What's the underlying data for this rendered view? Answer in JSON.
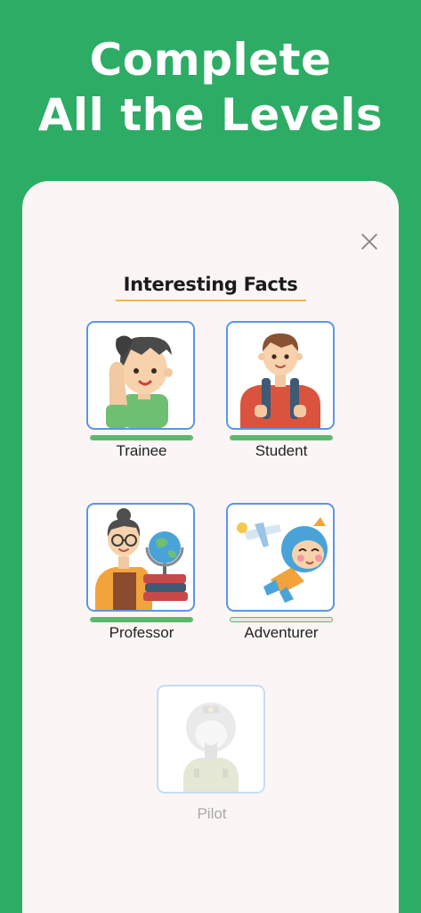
{
  "headline": {
    "line1": "Complete",
    "line2": "All the Levels"
  },
  "modal": {
    "title": "Interesting Facts",
    "levels": [
      {
        "name": "Trainee",
        "icon": "trainee-avatar-icon",
        "progress": 1.0,
        "locked": false
      },
      {
        "name": "Student",
        "icon": "student-avatar-icon",
        "progress": 1.0,
        "locked": false
      },
      {
        "name": "Professor",
        "icon": "professor-avatar-icon",
        "progress": 1.0,
        "locked": false
      },
      {
        "name": "Adventurer",
        "icon": "adventurer-avatar-icon",
        "progress": 0.0,
        "locked": false
      },
      {
        "name": "Pilot",
        "icon": "pilot-avatar-icon",
        "locked": true
      }
    ]
  },
  "colors": {
    "background": "#2dac65",
    "card": "#fbf6f5",
    "tile_border": "#5b96e6",
    "progress": "#5cb86e",
    "underline": "#f0b84a"
  }
}
